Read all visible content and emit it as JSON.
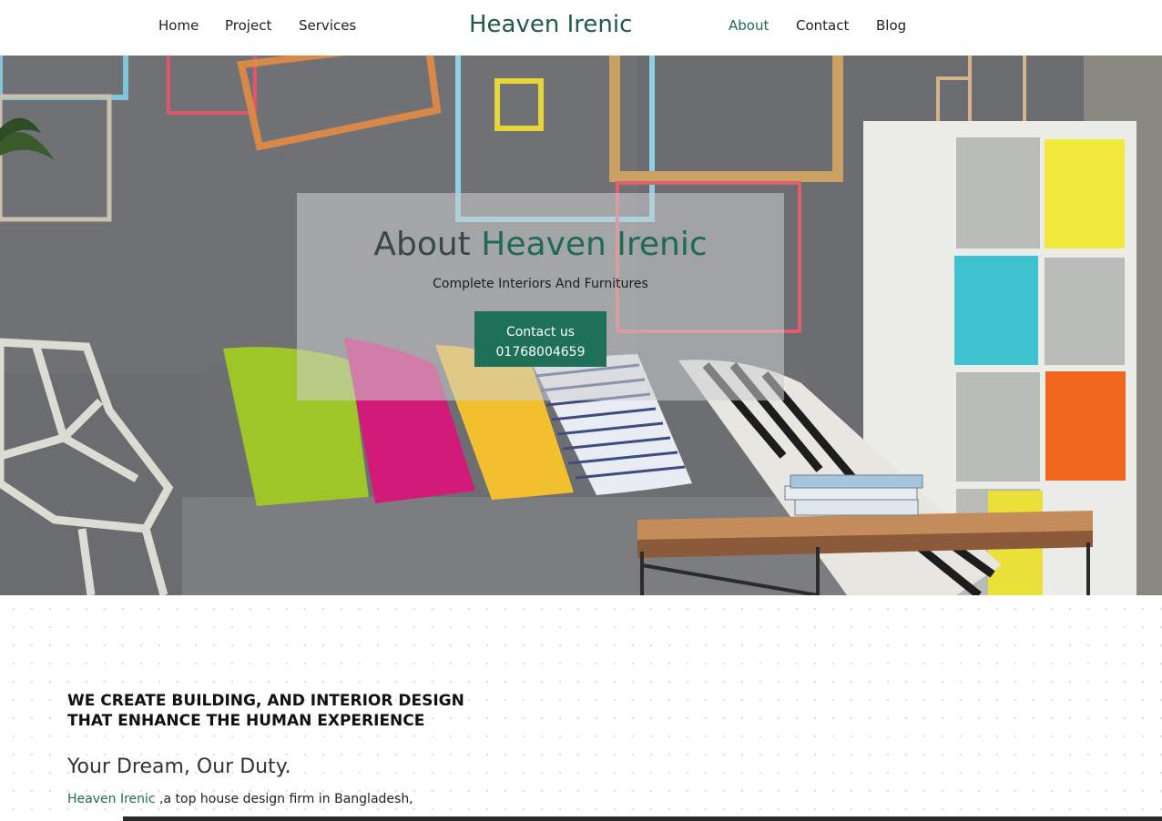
{
  "nav": {
    "left_links": [
      "Home",
      "Project",
      "Services"
    ],
    "brand": "Heaven Irenic",
    "right_links": [
      "About",
      "Contact",
      "Blog"
    ],
    "active": "About",
    "accent_color": "#1f6b52"
  },
  "hero": {
    "title_prefix": "About",
    "title_accent": "Heaven Irenic",
    "subtitle": "Complete Interiors And Furnitures",
    "button_line1": "Contact us",
    "button_line2": "01768004659",
    "button_color": "#1f7058"
  },
  "content": {
    "headline_line1": "WE CREATE BUILDING, AND INTERIOR DESIGN",
    "headline_line2": "THAT ENHANCE THE HUMAN EXPERIENCE",
    "tagline": "Your Dream, Our Duty.",
    "intro_brand": "Heaven Irenic",
    "intro_text": " ,a top house design firm in Bangladesh,"
  }
}
